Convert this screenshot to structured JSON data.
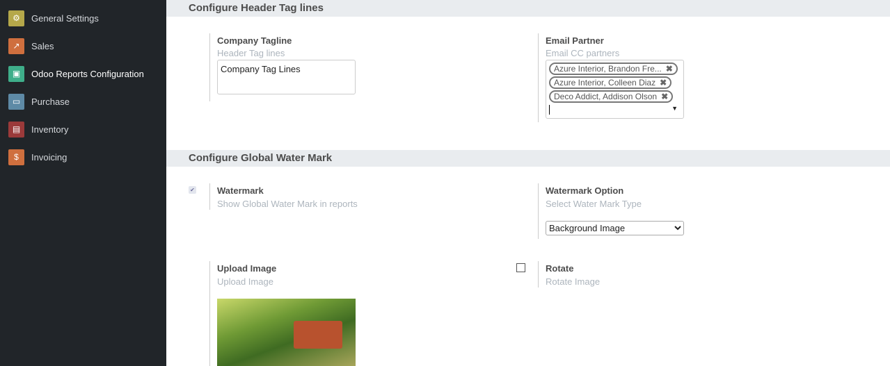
{
  "sidebar": {
    "items": [
      {
        "label": "General Settings",
        "icon": "gear-icon",
        "color": "#b5a84a"
      },
      {
        "label": "Sales",
        "icon": "chart-icon",
        "color": "#cf6f3e"
      },
      {
        "label": "Odoo Reports Configuration",
        "icon": "report-icon",
        "color": "#3fae8a",
        "active": true
      },
      {
        "label": "Purchase",
        "icon": "credit-card-icon",
        "color": "#5e8aa6"
      },
      {
        "label": "Inventory",
        "icon": "box-icon",
        "color": "#9b3a3a"
      },
      {
        "label": "Invoicing",
        "icon": "invoice-icon",
        "color": "#cf6f3e"
      }
    ]
  },
  "header_section": {
    "title": "Configure Header Tag lines",
    "tagline": {
      "label": "Company Tagline",
      "desc": "Header Tag lines",
      "value": "Company Tag Lines"
    },
    "email": {
      "label": "Email Partner",
      "desc": "Email CC partners",
      "tags": [
        "Azure Interior, Brandon Fre...",
        "Azure Interior, Colleen Diaz",
        "Deco Addict, Addison Olson"
      ],
      "remove": "✖"
    }
  },
  "watermark_section": {
    "title": "Configure Global Water Mark",
    "watermark": {
      "label": "Watermark",
      "desc": "Show Global Water Mark in reports",
      "checked": true
    },
    "option": {
      "label": "Watermark Option",
      "desc": "Select Water Mark Type",
      "value": "Background Image"
    },
    "upload": {
      "label": "Upload Image",
      "desc": "Upload Image"
    },
    "rotate": {
      "label": "Rotate",
      "desc": "Rotate Image",
      "checked": false
    }
  }
}
